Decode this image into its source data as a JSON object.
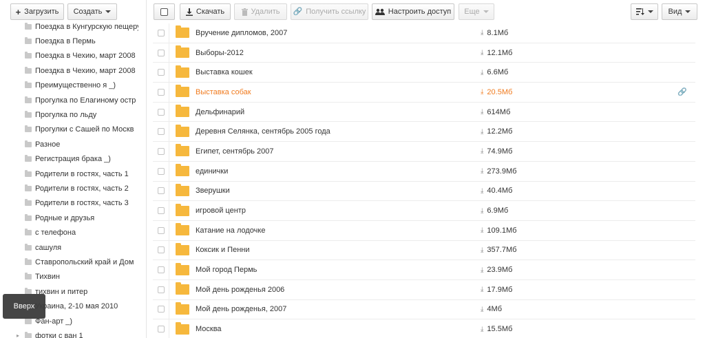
{
  "toolbar": {
    "upload_label": "Загрузить",
    "create_label": "Создать",
    "download_label": "Скачать",
    "delete_label": "Удалить",
    "get_link_label": "Получить ссылку",
    "access_label": "Настроить доступ",
    "more_label": "Еще",
    "view_label": "Вид"
  },
  "sidebar": {
    "items": [
      {
        "label": "Поездка в Кунгурскую пещеру"
      },
      {
        "label": "Поездка в Пермь"
      },
      {
        "label": "Поездка в Чехию, март 2008"
      },
      {
        "label": "Поездка в Чехию, март 2008"
      },
      {
        "label": "Преимущественно я _)"
      },
      {
        "label": "Прогулка по Елагиному остр"
      },
      {
        "label": "Прогулка по льду"
      },
      {
        "label": "Прогулки с Сашей по Москв"
      },
      {
        "label": "Разное"
      },
      {
        "label": "Регистрация брака _)"
      },
      {
        "label": "Родители в гостях, часть 1"
      },
      {
        "label": "Родители в гостях, часть 2"
      },
      {
        "label": "Родители в гостях, часть 3"
      },
      {
        "label": "Родные и друзья"
      },
      {
        "label": "с телефона"
      },
      {
        "label": "сашуля"
      },
      {
        "label": "Ставропольский край и Дом"
      },
      {
        "label": "Тихвин"
      },
      {
        "label": "тихвин и питер"
      },
      {
        "label": "Украина, 2-10 мая 2010"
      },
      {
        "label": "Фан-арт _)"
      },
      {
        "label": "фотки с ван 1"
      }
    ]
  },
  "files": [
    {
      "name": "Вручение дипломов, 2007",
      "size": "8.1Мб"
    },
    {
      "name": "Выборы-2012",
      "size": "12.1Мб"
    },
    {
      "name": "Выставка кошек",
      "size": "6.6Мб"
    },
    {
      "name": "Выставка собак",
      "size": "20.5Мб"
    },
    {
      "name": "Дельфинарий",
      "size": "614Мб"
    },
    {
      "name": "Деревня Селянка, сентябрь 2005 года",
      "size": "12.2Мб"
    },
    {
      "name": "Египет, сентябрь 2007",
      "size": "74.9Мб"
    },
    {
      "name": "единички",
      "size": "273.9Мб"
    },
    {
      "name": "Зверушки",
      "size": "40.4Мб"
    },
    {
      "name": "игровой центр",
      "size": "6.9Мб"
    },
    {
      "name": "Катание на лодочке",
      "size": "109.1Мб"
    },
    {
      "name": "Коксик и Пенни",
      "size": "357.7Мб"
    },
    {
      "name": "Мой город Пермь",
      "size": "23.9Мб"
    },
    {
      "name": "Мой день рожденья 2006",
      "size": "17.9Мб"
    },
    {
      "name": "Мой день рожденья, 2007",
      "size": "4Мб"
    },
    {
      "name": "Москва",
      "size": "15.5Мб"
    }
  ],
  "up_label": "Вверх",
  "colors": {
    "highlight": "#f07b1f",
    "folder": "#f6b83d"
  }
}
